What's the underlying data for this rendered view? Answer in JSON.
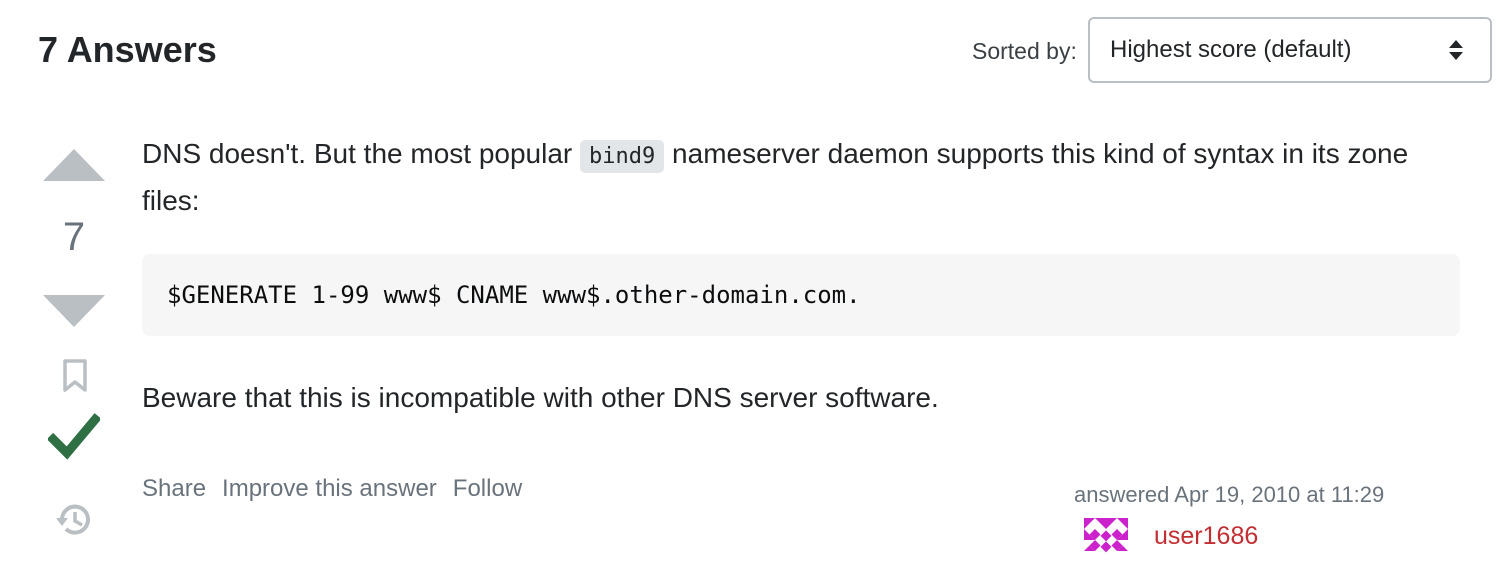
{
  "header": {
    "answers_count": "7 Answers",
    "sort_label": "Sorted by:",
    "sort_value": "Highest score (default)"
  },
  "vote": {
    "score": "7"
  },
  "answer": {
    "para1_before": "DNS doesn't. But the most popular ",
    "para1_code": "bind9",
    "para1_after": " nameserver daemon supports this kind of syntax in its zone files:",
    "code_block": "$GENERATE 1-99 www$ CNAME www$.other-domain.com.",
    "para2": "Beware that this is incompatible with other DNS server software."
  },
  "post_menu": {
    "share": "Share",
    "improve": "Improve this answer",
    "follow": "Follow"
  },
  "user": {
    "action_time": "answered Apr 19, 2010 at 11:29",
    "name": "user1686"
  },
  "colors": {
    "accepted": "#2f6f44",
    "vote_arrow": "#babfc4",
    "user_name": "#c22e32",
    "avatar": "#cc22cc"
  },
  "icons": {
    "vote_up": "triangle-up-icon",
    "vote_down": "triangle-down-icon",
    "bookmark": "bookmark-icon",
    "accepted": "checkmark-icon",
    "history": "history-icon",
    "sort_caret": "sort-caret-icon"
  }
}
